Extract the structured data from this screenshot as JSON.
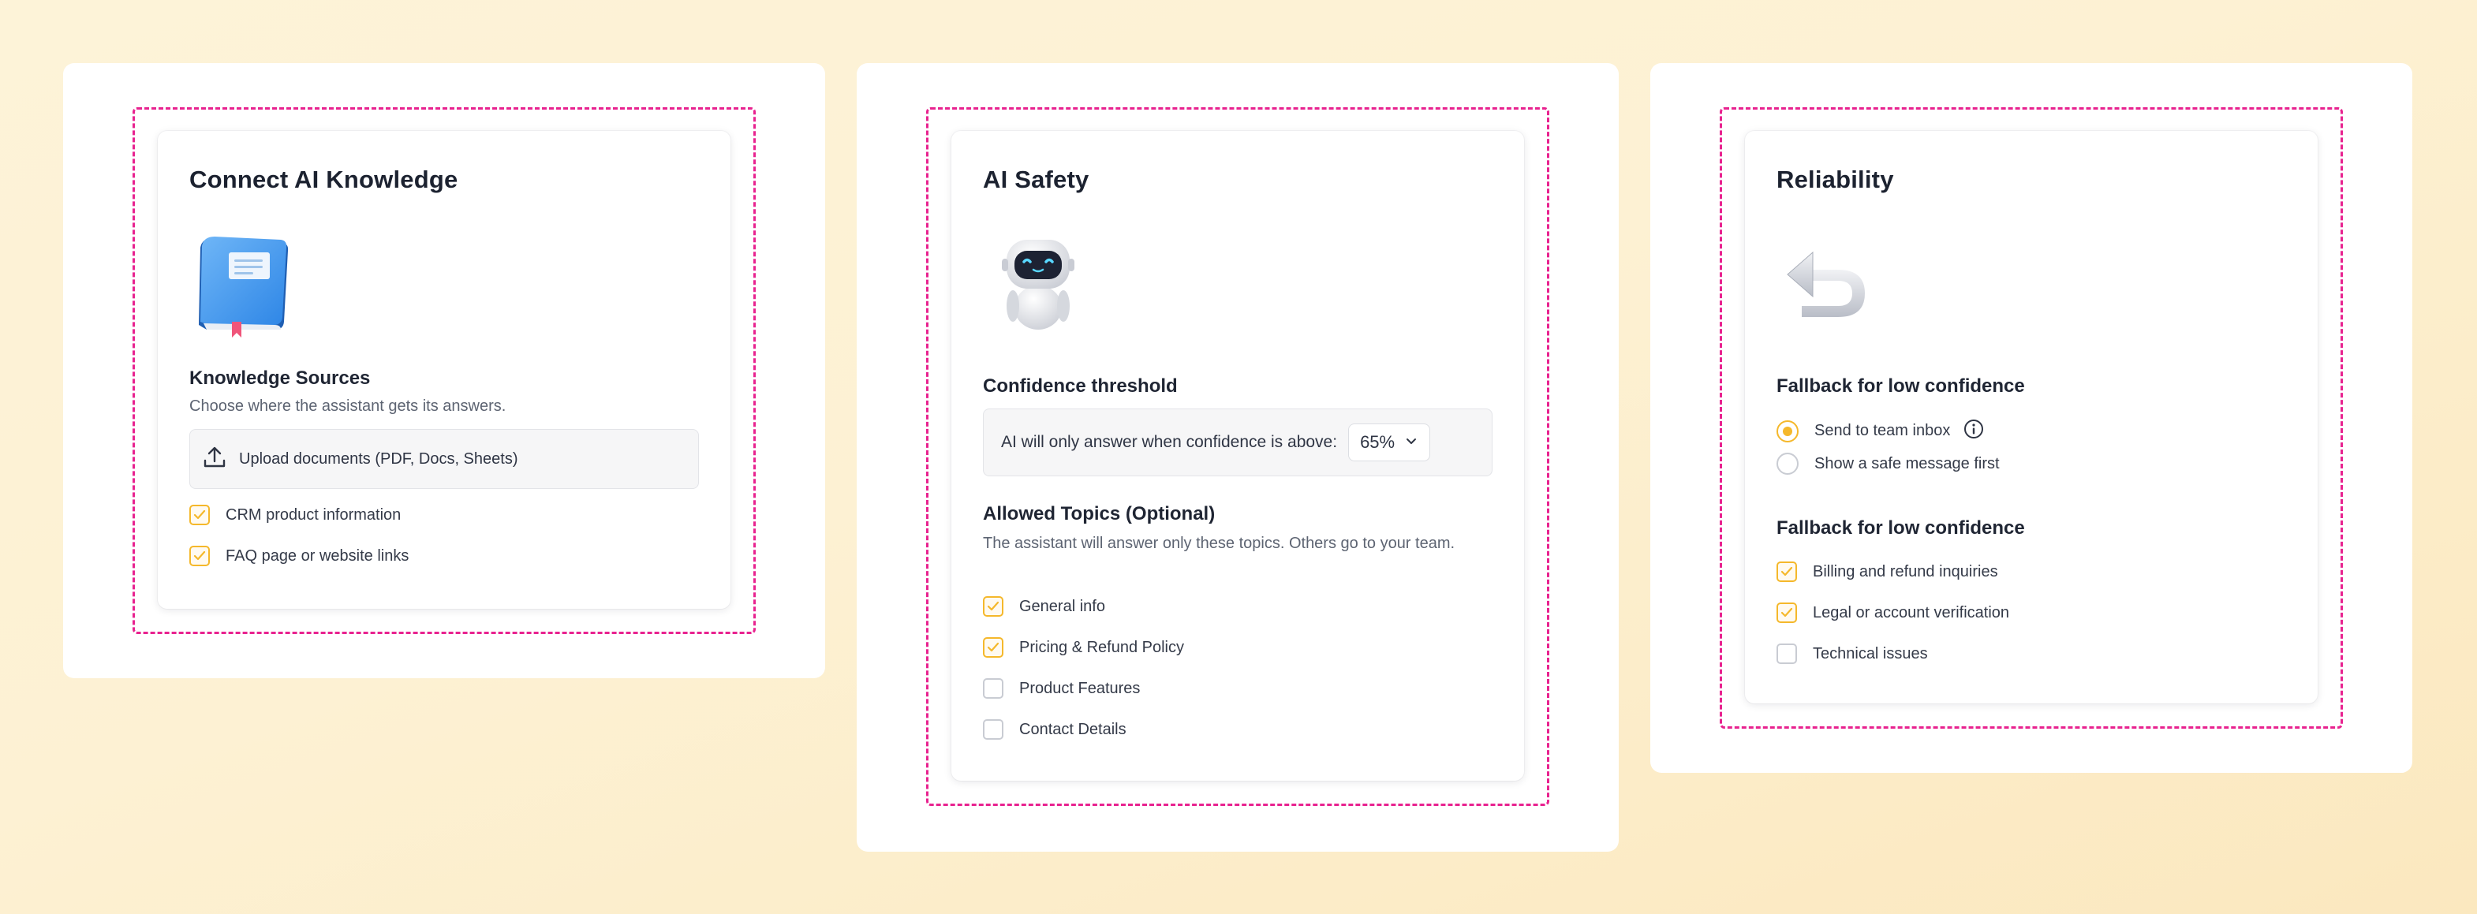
{
  "panels": {
    "knowledge": {
      "title": "Connect AI Knowledge",
      "illustration": "blue-book-icon",
      "section_title": "Knowledge Sources",
      "section_desc": "Choose where the assistant gets its answers.",
      "upload_label": "Upload documents (PDF, Docs, Sheets)",
      "options": [
        {
          "label": "CRM product information",
          "checked": true
        },
        {
          "label": "FAQ page or website links",
          "checked": true
        }
      ]
    },
    "safety": {
      "title": "AI Safety",
      "illustration": "robot-icon",
      "threshold_title": "Confidence threshold",
      "threshold_label": "AI will only answer when confidence is above:",
      "threshold_value": "65%",
      "topics_title": "Allowed Topics (Optional)",
      "topics_desc": "The assistant will answer only these topics. Others go to your team.",
      "topics": [
        {
          "label": "General info",
          "checked": true
        },
        {
          "label": "Pricing & Refund Policy",
          "checked": true
        },
        {
          "label": "Product Features",
          "checked": false
        },
        {
          "label": "Contact Details",
          "checked": false
        }
      ]
    },
    "reliability": {
      "title": "Reliability",
      "illustration": "return-arrow-icon",
      "fallback_title": "Fallback for low confidence",
      "fallback_options": [
        {
          "label": "Send to team inbox",
          "selected": true
        },
        {
          "label": "Show a safe message first",
          "selected": false
        }
      ],
      "escalate_title": "Fallback for low confidence",
      "escalate_options": [
        {
          "label": "Billing and refund inquiries",
          "checked": true
        },
        {
          "label": "Legal or account verification",
          "checked": true
        },
        {
          "label": "Technical issues",
          "checked": false
        }
      ]
    }
  },
  "colors": {
    "accent": "#f5b82b",
    "dashed_outline": "#e8228f",
    "background": "#fdf1d3"
  }
}
